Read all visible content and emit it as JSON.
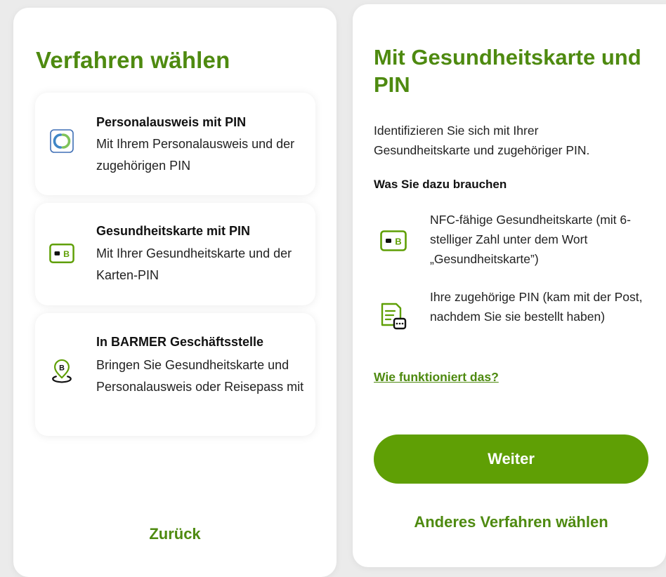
{
  "left": {
    "title": "Verfahren wählen",
    "cards": [
      {
        "title": "Personalausweis mit PIN",
        "description": "Mit Ihrem Personalausweis und der zugehörigen PIN",
        "icon": "id-card-icon"
      },
      {
        "title": "Gesundheitskarte mit PIN",
        "description": "Mit Ihrer Gesundheitskarte und der Karten-PIN",
        "icon": "health-card-icon"
      },
      {
        "title": "In BARMER Geschäftsstelle",
        "description": "Bringen Sie Gesundheitskarte und Personalausweis oder Reisepass mit",
        "icon": "location-pin-icon"
      }
    ],
    "back_label": "Zurück"
  },
  "right": {
    "title": "Mit Gesundheitskarte und PIN",
    "intro": "Identifizieren Sie sich mit Ihrer Gesundheitskarte und zugehöriger PIN.",
    "needs_heading": "Was Sie dazu brauchen",
    "needs": [
      {
        "text": "NFC-fähige Gesundheitskarte (mit 6-stelliger Zahl unter dem Wort „Gesundheitskarte”)",
        "icon": "health-card-icon"
      },
      {
        "text": "Ihre zugehörige PIN (kam mit der Post, nachdem Sie sie bestellt haben)",
        "icon": "pin-letter-icon"
      }
    ],
    "how_link": "Wie funktioniert das?",
    "continue_label": "Weiter",
    "other_method_label": "Anderes Verfahren wählen"
  },
  "colors": {
    "brand_green": "#5f9f05",
    "heading_green": "#4e8a10",
    "background": "#ebebeb"
  }
}
